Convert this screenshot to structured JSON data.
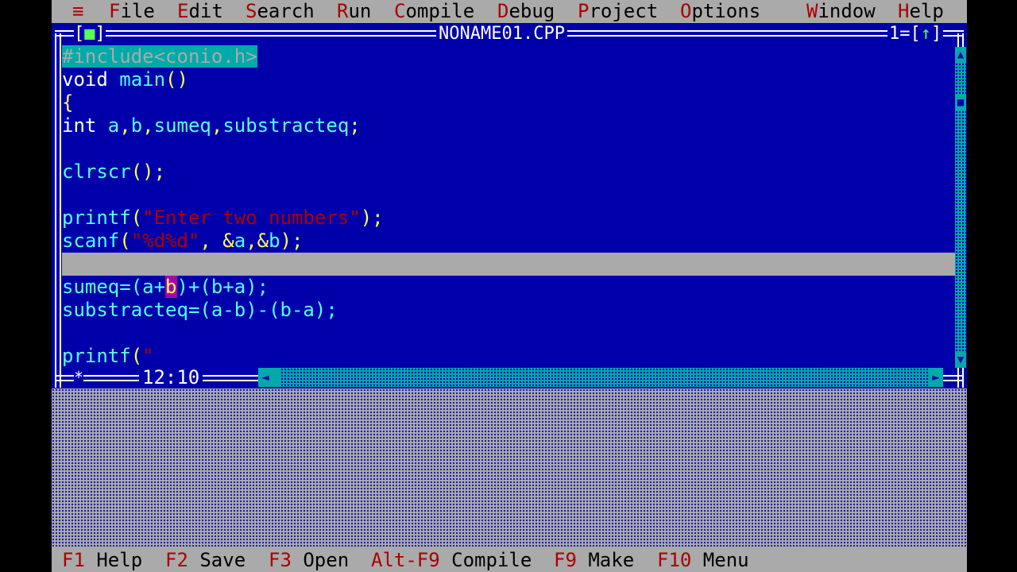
{
  "menubar": {
    "system": "≡",
    "items": [
      {
        "hot": "F",
        "rest": "ile"
      },
      {
        "hot": "E",
        "rest": "dit"
      },
      {
        "hot": "S",
        "rest": "earch"
      },
      {
        "hot": "R",
        "rest": "un"
      },
      {
        "hot": "C",
        "rest": "ompile"
      },
      {
        "hot": "D",
        "rest": "ebug"
      },
      {
        "hot": "P",
        "rest": "roject"
      },
      {
        "hot": "O",
        "rest": "ptions"
      },
      {
        "hot": "W",
        "rest": "indow"
      },
      {
        "hot": "H",
        "rest": "elp"
      }
    ]
  },
  "window": {
    "title": "NONAME01.CPP",
    "close_left": "[",
    "close_mark": "■",
    "close_right": "]",
    "number": "1=",
    "zoom_left": "[",
    "zoom_mark": "↑",
    "zoom_right": "]",
    "cursor_pos": "12:10",
    "modified_mark": "*",
    "arrows": {
      "up": "▲",
      "down": "▼",
      "left": "◄",
      "right": "►",
      "thumb": "■"
    }
  },
  "code": {
    "l1": "#include<conio.h>",
    "l2_kw": "void",
    "l2_fn": " main",
    "l2_pn": "()",
    "l3": "{",
    "l4_kw": "int",
    "l4_a": " a",
    "l4_c1": ",",
    "l4_b": "b",
    "l4_c2": ",",
    "l4_s": "sumeq",
    "l4_c3": ",",
    "l4_d": "substracteq",
    "l4_end": ";",
    "l6_fn": "clrscr",
    "l6_end": "();",
    "l8_fn": "printf",
    "l8_open": "(",
    "l8_str": "\"Enter two numbers\"",
    "l8_end": ");",
    "l9_fn": "scanf",
    "l9_open": "(",
    "l9_str": "\"%d%d\"",
    "l9_mid": ", &",
    "l9_a": "a",
    "l9_c": ",&",
    "l9_b": "b",
    "l9_end": ");",
    "l11_a": "sumeq=(a+",
    "l11_caret": "b",
    "l11_b": ")+(b+a);",
    "l12": "substracteq=(a-b)-(b-a);",
    "l14_fn": "printf",
    "l14_open": "(",
    "l14_str": "\""
  },
  "statusbar": [
    {
      "key": "F1",
      "label": " Help"
    },
    {
      "key": "F2",
      "label": " Save"
    },
    {
      "key": "F3",
      "label": " Open"
    },
    {
      "key": "Alt-F9",
      "label": " Compile"
    },
    {
      "key": "F9",
      "label": " Make"
    },
    {
      "key": "F10",
      "label": " Menu"
    }
  ]
}
